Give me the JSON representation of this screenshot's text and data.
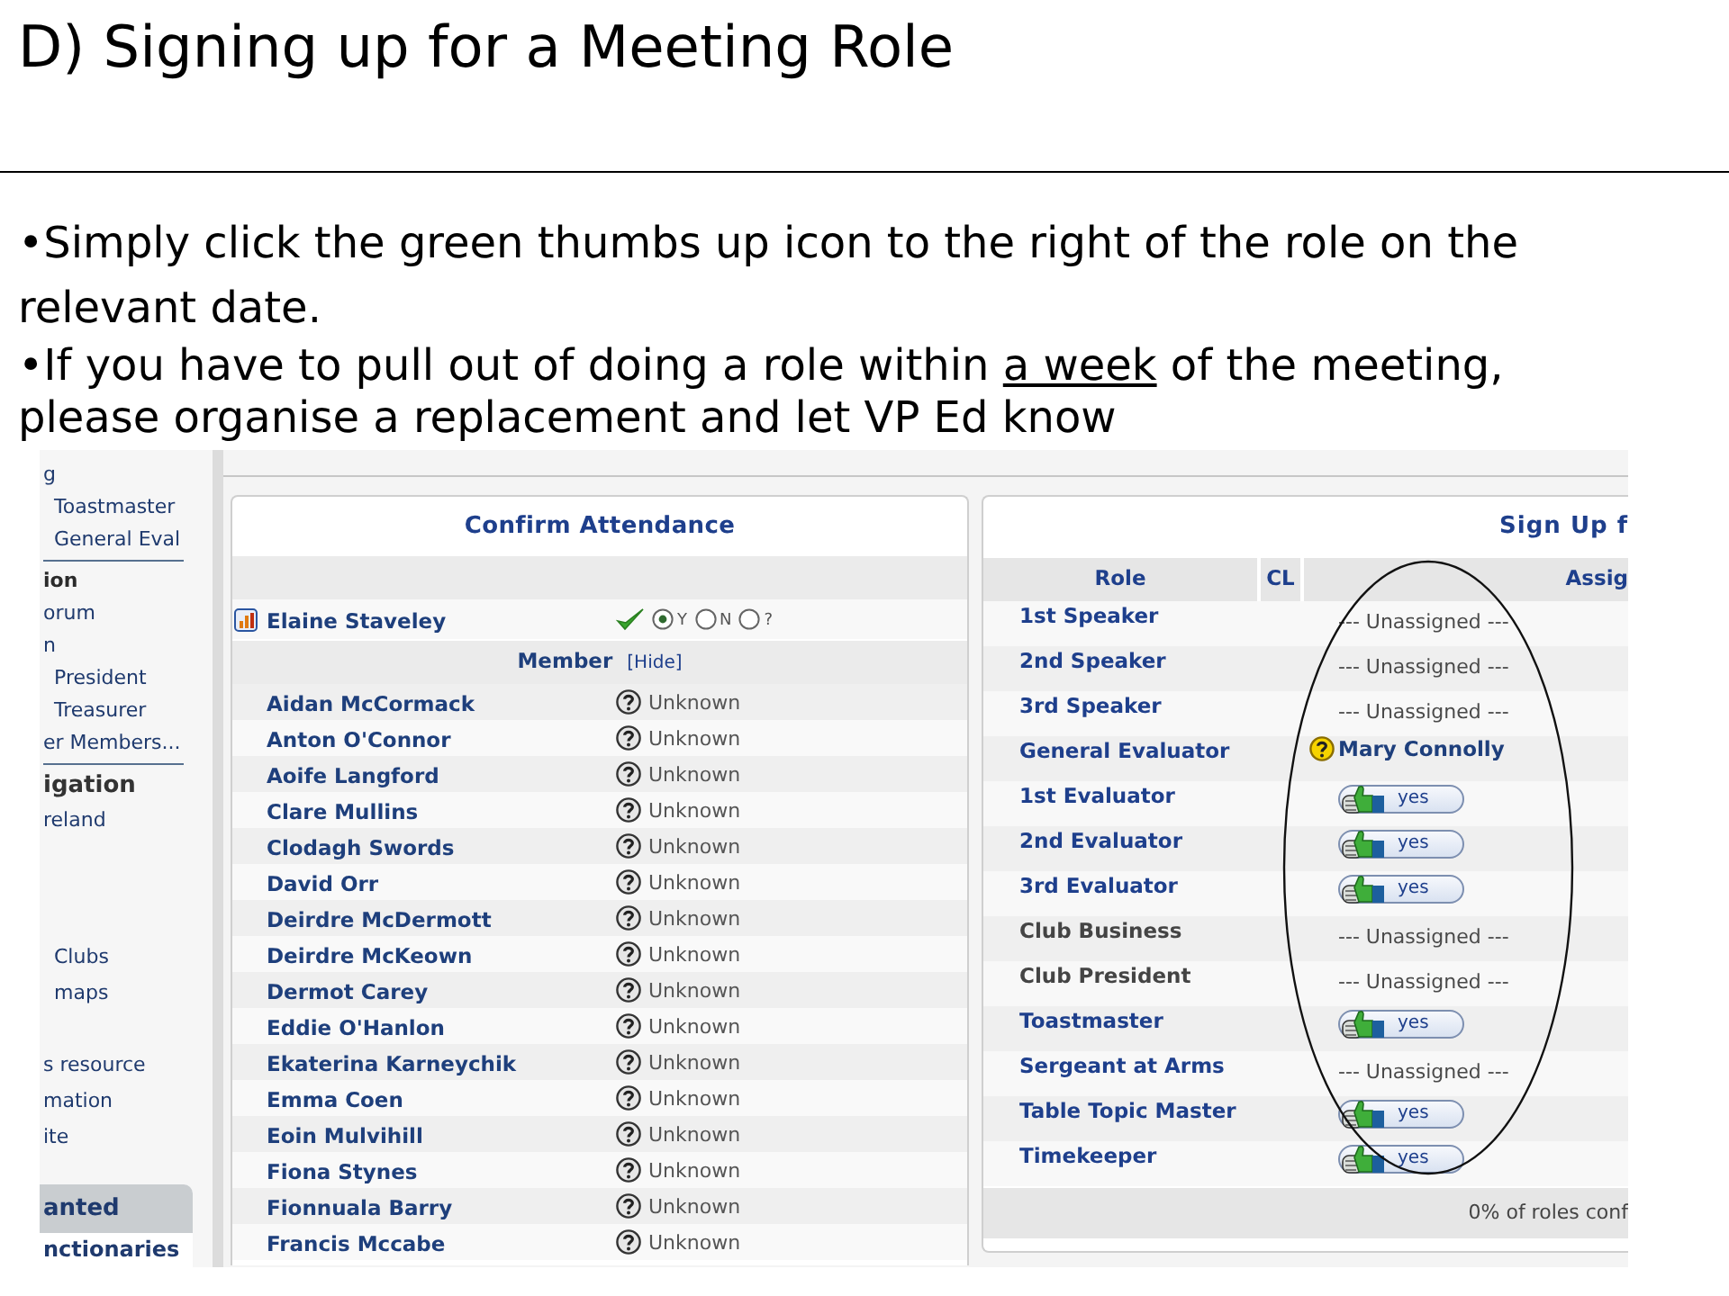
{
  "slide": {
    "title": "D) Signing up for a Meeting Role"
  },
  "bullets": [
    {
      "parts": [
        {
          "text": "•Simply click the green thumbs up icon to the right of the role on the relevant date.",
          "underline": false
        }
      ]
    },
    {
      "parts": [
        {
          "text": "•If you have to pull out of doing a role within ",
          "underline": false
        },
        {
          "text": "a week",
          "underline": true
        },
        {
          "text": " of the meeting, please organise a replacement and let VP Ed know",
          "underline": false
        }
      ]
    }
  ],
  "sidebar": {
    "groups": [
      {
        "divider": true,
        "items": [
          {
            "label": "g",
            "kind": "link"
          },
          {
            "label": "Toastmaster",
            "kind": "sub"
          },
          {
            "label": "General Eval",
            "kind": "sub"
          }
        ]
      },
      {
        "divider": true,
        "items": [
          {
            "label": "ion",
            "kind": "group"
          },
          {
            "label": "orum",
            "kind": "link"
          },
          {
            "label": "n",
            "kind": "link"
          },
          {
            "label": "President",
            "kind": "sub"
          },
          {
            "label": "Treasurer",
            "kind": "sub"
          },
          {
            "label": "er Members...",
            "kind": "link"
          }
        ]
      },
      {
        "divider": false,
        "items": [
          {
            "label": "igation",
            "kind": "heading"
          },
          {
            "label": "reland",
            "kind": "link"
          }
        ]
      },
      {
        "divider": false,
        "items": [
          {
            "label": "Clubs",
            "kind": "sub"
          },
          {
            "label": "maps",
            "kind": "sub"
          }
        ]
      },
      {
        "divider": false,
        "items": [
          {
            "label": "s resource",
            "kind": "link"
          },
          {
            "label": "mation",
            "kind": "link"
          },
          {
            "label": "ite",
            "kind": "link"
          }
        ]
      }
    ],
    "box": {
      "title": "anted",
      "link": "nctionaries"
    }
  },
  "attendance": {
    "title": "Confirm Attendance",
    "me": {
      "name": "Elaine Staveley",
      "confirmed": true,
      "options": [
        {
          "label": "Y",
          "selected": true
        },
        {
          "label": "N",
          "selected": false
        },
        {
          "label": "?",
          "selected": false
        }
      ]
    },
    "group": {
      "label": "Member",
      "action": "[Hide]"
    },
    "members": [
      {
        "name": "Aidan McCormack",
        "status": "Unknown"
      },
      {
        "name": "Anton O'Connor",
        "status": "Unknown"
      },
      {
        "name": "Aoife Langford",
        "status": "Unknown"
      },
      {
        "name": "Clare Mullins",
        "status": "Unknown"
      },
      {
        "name": "Clodagh Swords",
        "status": "Unknown"
      },
      {
        "name": "David Orr",
        "status": "Unknown"
      },
      {
        "name": "Deirdre McDermott",
        "status": "Unknown"
      },
      {
        "name": "Deirdre McKeown",
        "status": "Unknown"
      },
      {
        "name": "Dermot Carey",
        "status": "Unknown"
      },
      {
        "name": "Eddie O'Hanlon",
        "status": "Unknown"
      },
      {
        "name": "Ekaterina Karneychik",
        "status": "Unknown"
      },
      {
        "name": "Emma Coen",
        "status": "Unknown"
      },
      {
        "name": "Eoin Mulvihill",
        "status": "Unknown"
      },
      {
        "name": "Fiona Stynes",
        "status": "Unknown"
      },
      {
        "name": "Fionnuala Barry",
        "status": "Unknown"
      },
      {
        "name": "Francis Mccabe",
        "status": "Unknown"
      }
    ]
  },
  "signup": {
    "title": "Sign Up f",
    "columns": [
      "Role",
      "CL",
      "Assig"
    ],
    "roles": [
      {
        "role": "1st Speaker",
        "linked": true,
        "assignment": {
          "kind": "unassigned",
          "text": "--- Unassigned ---"
        }
      },
      {
        "role": "2nd Speaker",
        "linked": true,
        "assignment": {
          "kind": "unassigned",
          "text": "--- Unassigned ---"
        }
      },
      {
        "role": "3rd Speaker",
        "linked": true,
        "assignment": {
          "kind": "unassigned",
          "text": "--- Unassigned ---"
        }
      },
      {
        "role": "General Evaluator",
        "linked": true,
        "assignment": {
          "kind": "member",
          "text": "Mary Connolly"
        }
      },
      {
        "role": "1st Evaluator",
        "linked": true,
        "assignment": {
          "kind": "signup",
          "text": "yes"
        }
      },
      {
        "role": "2nd Evaluator",
        "linked": true,
        "assignment": {
          "kind": "signup",
          "text": "yes"
        }
      },
      {
        "role": "3rd Evaluator",
        "linked": true,
        "assignment": {
          "kind": "signup",
          "text": "yes"
        }
      },
      {
        "role": "Club Business",
        "linked": false,
        "assignment": {
          "kind": "unassigned",
          "text": "--- Unassigned ---"
        }
      },
      {
        "role": "Club President",
        "linked": false,
        "assignment": {
          "kind": "unassigned",
          "text": "--- Unassigned ---"
        }
      },
      {
        "role": "Toastmaster",
        "linked": true,
        "assignment": {
          "kind": "signup",
          "text": "yes"
        }
      },
      {
        "role": "Sergeant at Arms",
        "linked": true,
        "assignment": {
          "kind": "unassigned",
          "text": "--- Unassigned ---"
        }
      },
      {
        "role": "Table Topic Master",
        "linked": true,
        "assignment": {
          "kind": "signup",
          "text": "yes"
        }
      },
      {
        "role": "Timekeeper",
        "linked": true,
        "assignment": {
          "kind": "signup",
          "text": "yes"
        }
      }
    ],
    "footer": "0% of roles conf"
  }
}
